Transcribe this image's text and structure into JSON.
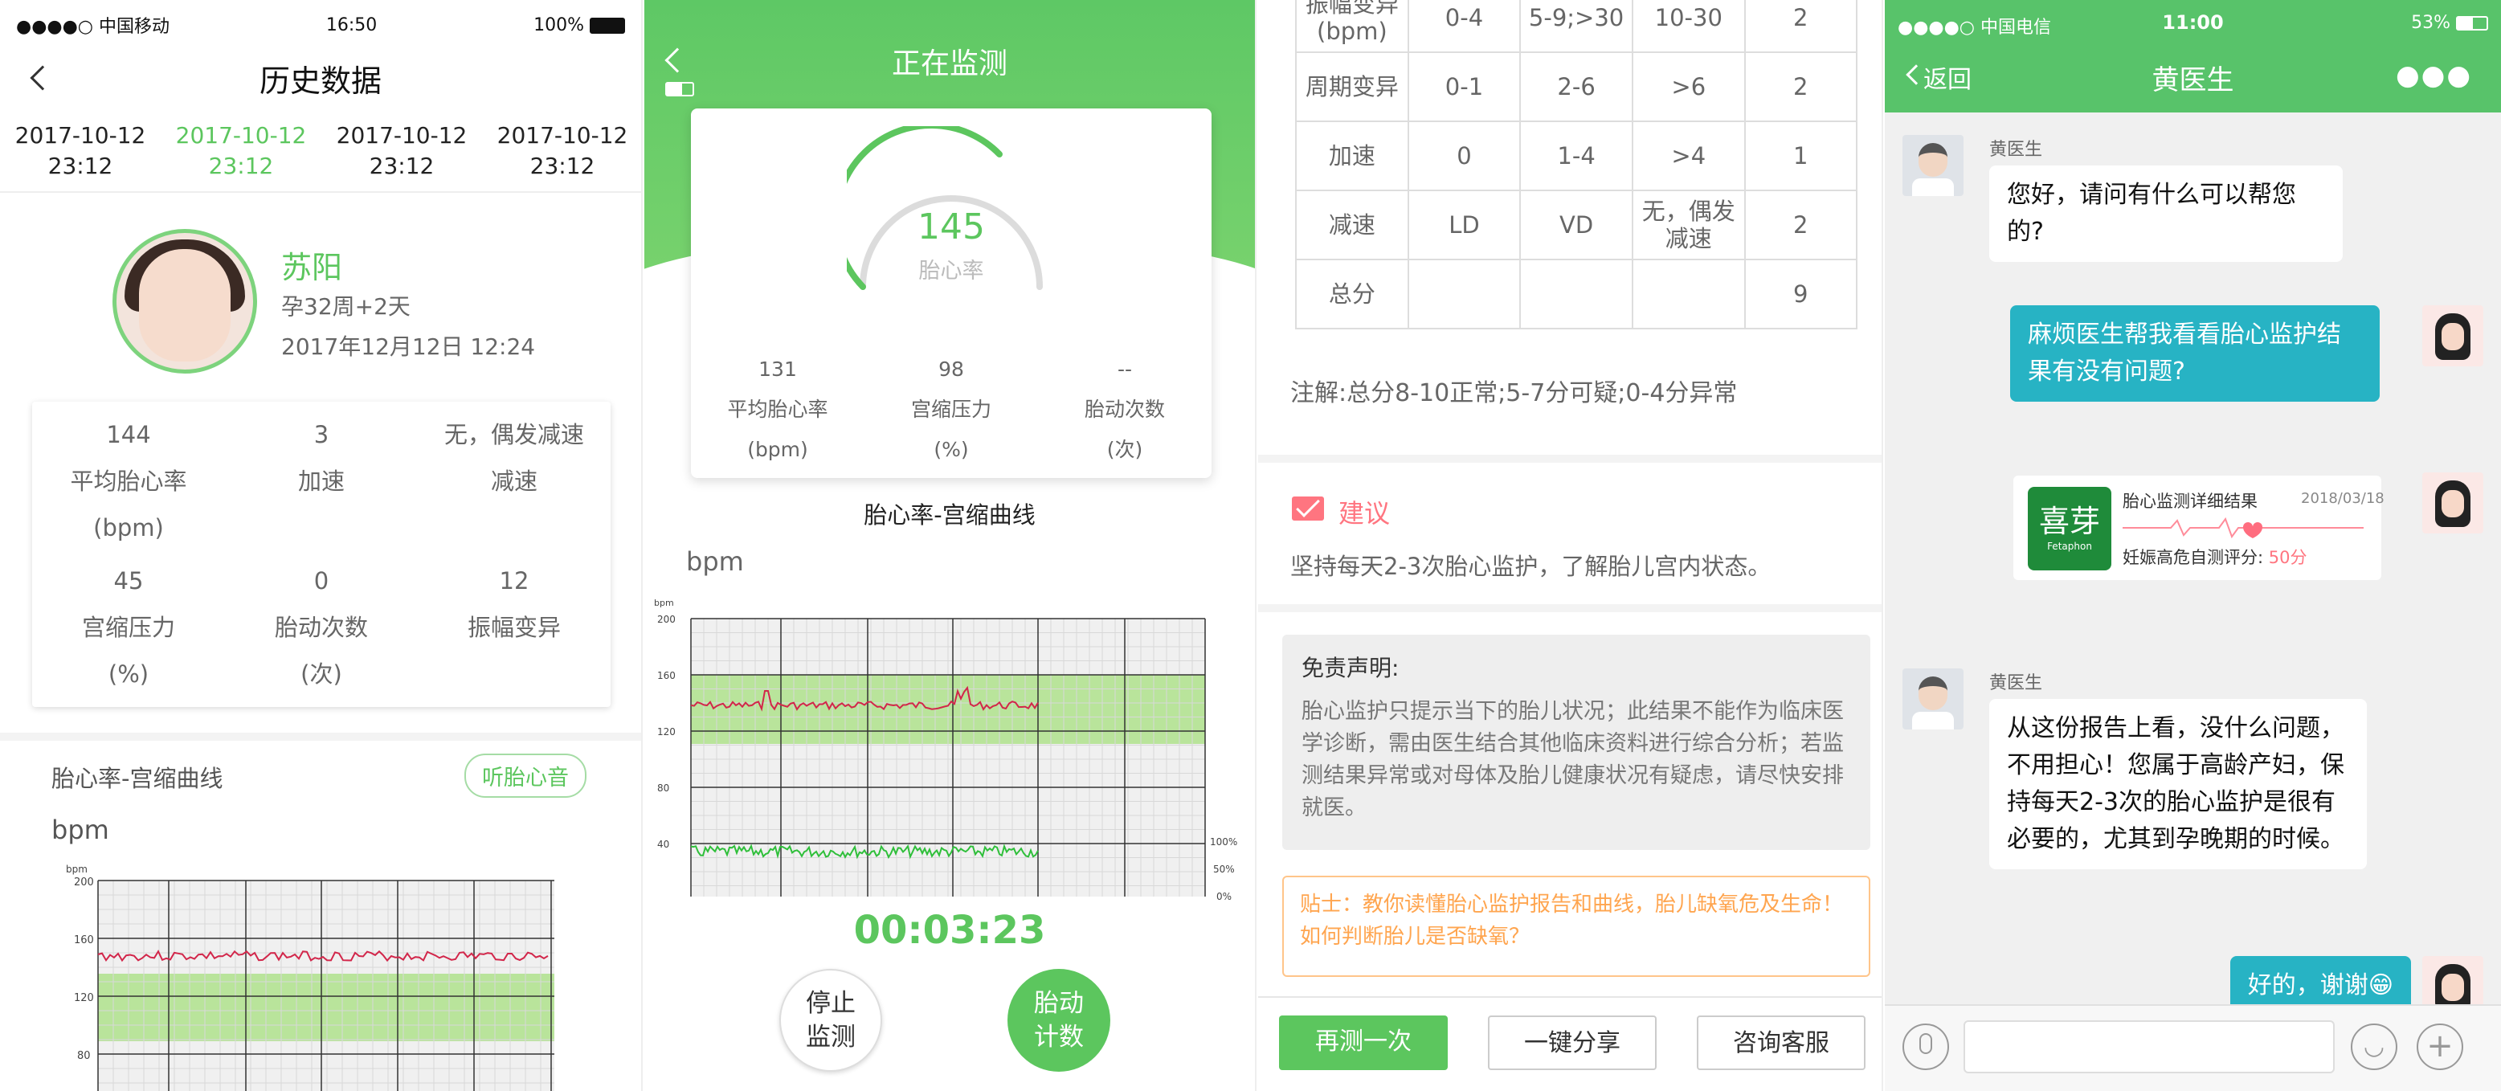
{
  "panel1": {
    "status": {
      "carrier": "●●●●○ 中国移动",
      "time": "16:50",
      "battery": "100%"
    },
    "title": "历史数据",
    "dates": [
      {
        "date": "2017-10-12",
        "time": "23:12",
        "active": false
      },
      {
        "date": "2017-10-12",
        "time": "23:12",
        "active": true
      },
      {
        "date": "2017-10-12",
        "time": "23:12",
        "active": false
      },
      {
        "date": "2017-10-12",
        "time": "23:12",
        "active": false
      }
    ],
    "profile": {
      "name": "苏阳",
      "week": "孕32周+2天",
      "datetime": "2017年12月12日  12:24"
    },
    "stats": [
      {
        "value": "144",
        "label": "平均胎心率",
        "unit": "(bpm)"
      },
      {
        "value": "3",
        "label": "加速",
        "unit": ""
      },
      {
        "value": "无，偶发减速",
        "label": "减速",
        "unit": ""
      },
      {
        "value": "45",
        "label": "宫缩压力",
        "unit": "(%)"
      },
      {
        "value": "0",
        "label": "胎动次数",
        "unit": "(次)"
      },
      {
        "value": "12",
        "label": "振幅变异",
        "unit": ""
      }
    ],
    "curve_title": "胎心率-宫缩曲线",
    "listen_btn": "听胎心音",
    "bpm_label": "bpm",
    "chart_unit": "bpm",
    "chart_ticks": [
      "200",
      "160",
      "120",
      "80"
    ]
  },
  "panel2": {
    "title": "正在监测",
    "heart_rate": "145",
    "heart_label": "胎心率",
    "metrics": [
      {
        "value": "131",
        "label": "平均胎心率",
        "unit": "(bpm)"
      },
      {
        "value": "98",
        "label": "宫缩压力",
        "unit": "(%)"
      },
      {
        "value": "--",
        "label": "胎动次数",
        "unit": "(次)"
      }
    ],
    "curve_title": "胎心率-宫缩曲线",
    "bpm_label": "bpm",
    "chart_unit": "bpm",
    "left_ticks": [
      "200",
      "160",
      "120",
      "80",
      "40"
    ],
    "right_ticks": [
      "100%",
      "50%",
      "0%"
    ],
    "timer": "00:03:23",
    "stop_btn": [
      "停止",
      "监测"
    ],
    "move_btn": [
      "胎动",
      "计数"
    ]
  },
  "panel3": {
    "rows": [
      [
        "振幅变异\n(bpm)",
        "0-4",
        "5-9;>30",
        "10-30",
        "2"
      ],
      [
        "周期变异",
        "0-1",
        "2-6",
        ">6",
        "2"
      ],
      [
        "加速",
        "0",
        "1-4",
        ">4",
        "1"
      ],
      [
        "减速",
        "LD",
        "VD",
        "无，偶发\n减速",
        "2"
      ],
      [
        "总分",
        "",
        "",
        "",
        "9"
      ]
    ],
    "note": "注解:总分8-10正常;5-7分可疑;0-4分异常",
    "advice_title": "建议",
    "advice_text": "坚持每天2-3次胎心监护，了解胎儿宫内状态。",
    "disclaimer_title": "免责声明:",
    "disclaimer_text": "胎心监护只提示当下的胎儿状况；此结果不能作为临床医学诊断，需由医生结合其他临床资料进行综合分析；若监测结果异常或对母体及胎儿健康状况有疑虑，请尽快安排就医。",
    "tip": "贴士：教你读懂胎心监护报告和曲线，胎儿缺氧危及生命！如何判断胎儿是否缺氧？",
    "buttons": [
      "再测一次",
      "一键分享",
      "咨询客服"
    ]
  },
  "panel4": {
    "status": {
      "carrier": "●●●●○ 中国电信",
      "time": "11:00",
      "battery": "53%"
    },
    "back": "返回",
    "title": "黄医生",
    "doctor_name": "黄医生",
    "msg1": "您好，请问有什么可以帮您的?",
    "msg2": "麻烦医生帮我看看胎心监护结果有没有问题?",
    "card": {
      "logo": "喜芽",
      "logo_sub": "Fetaphon",
      "title": "胎心监测详细结果",
      "date": "2018/03/18",
      "score_label": "妊娠高危自测评分:",
      "score": "50分"
    },
    "msg3": "从这份报告上看，没什么问题，不用担心！您属于高龄产妇，保持每天2-3次的胎心监护是很有必要的，尤其到孕晚期的时候。",
    "msg4": "好的，谢谢😁"
  },
  "colors": {
    "green": "#5cc65e",
    "chat_header": "#58c36a",
    "bubble_blue": "#27b3c4",
    "tip_orange": "#ffa54f",
    "advice_pink": "#ff7580"
  }
}
